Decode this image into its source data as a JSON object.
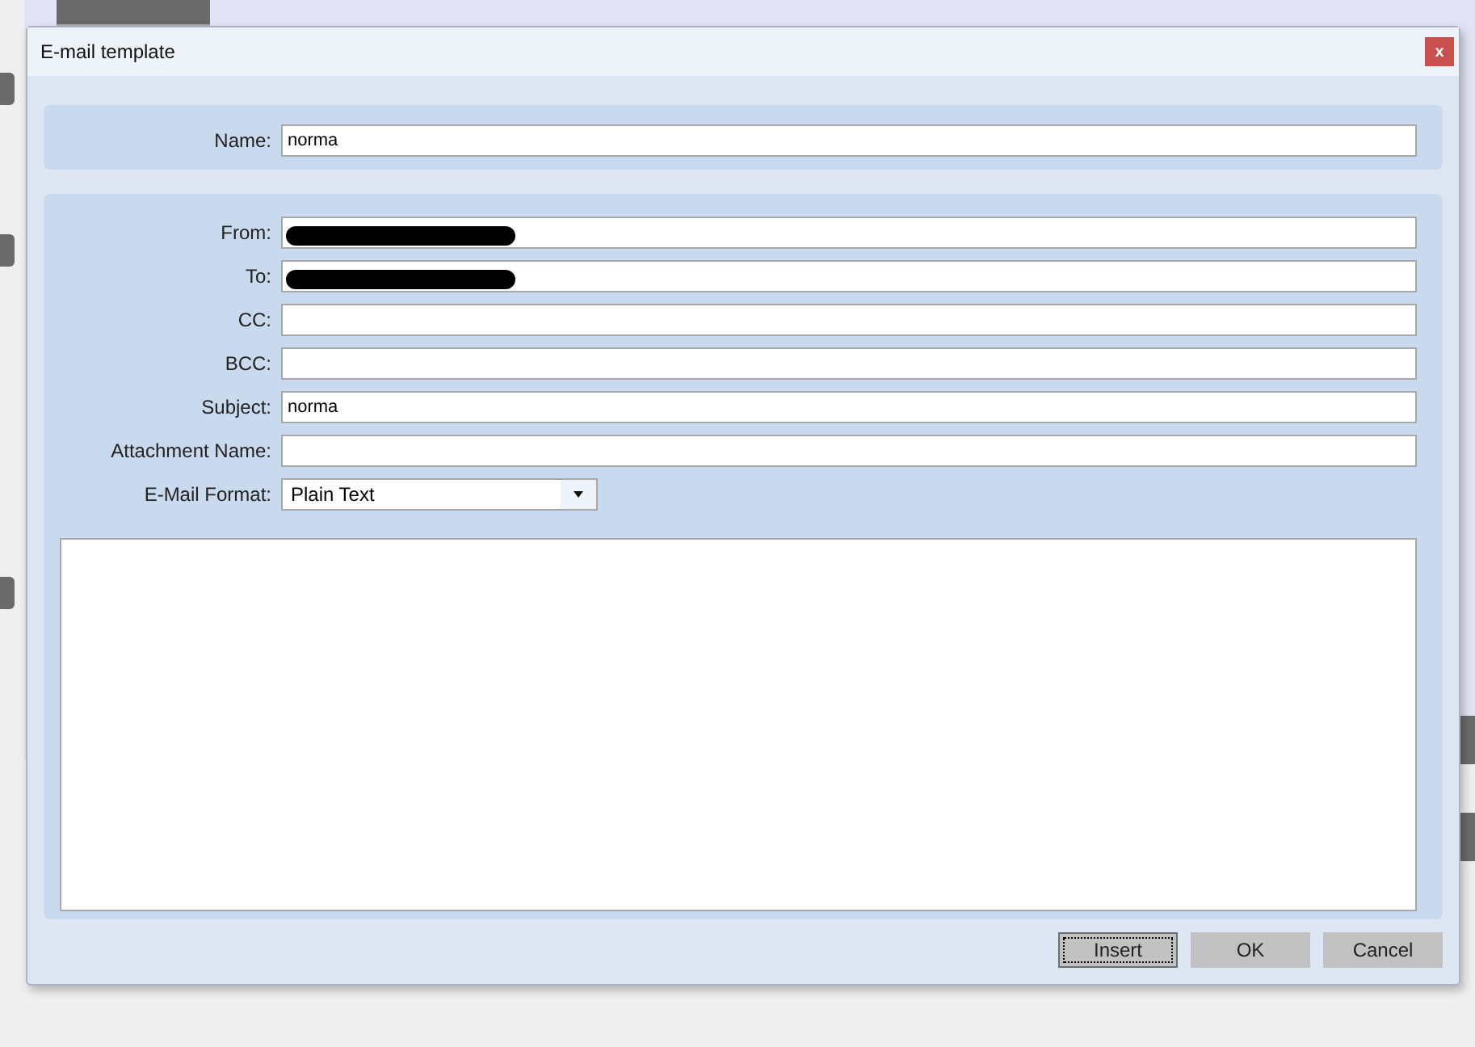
{
  "dialog": {
    "title": "E-mail template",
    "close": "x"
  },
  "name_field": {
    "label": "Name:",
    "value": "norma"
  },
  "fields": [
    {
      "kind": "text",
      "label": "From:",
      "redacted": true
    },
    {
      "kind": "text",
      "label": "To:",
      "redacted": true
    },
    {
      "kind": "text",
      "label": "CC:",
      "redacted": false
    },
    {
      "kind": "text",
      "label": "BCC:",
      "redacted": false
    },
    {
      "kind": "text",
      "label": "Subject:",
      "value": "norma",
      "redacted": false
    },
    {
      "kind": "text",
      "label": "Attachment Name:",
      "redacted": false
    },
    {
      "kind": "select",
      "label": "E-Mail Format:",
      "value": "Plain Text"
    }
  ],
  "buttons": [
    {
      "label": "Insert",
      "focused": true
    },
    {
      "label": "OK",
      "focused": false
    },
    {
      "label": "Cancel",
      "focused": false
    }
  ]
}
